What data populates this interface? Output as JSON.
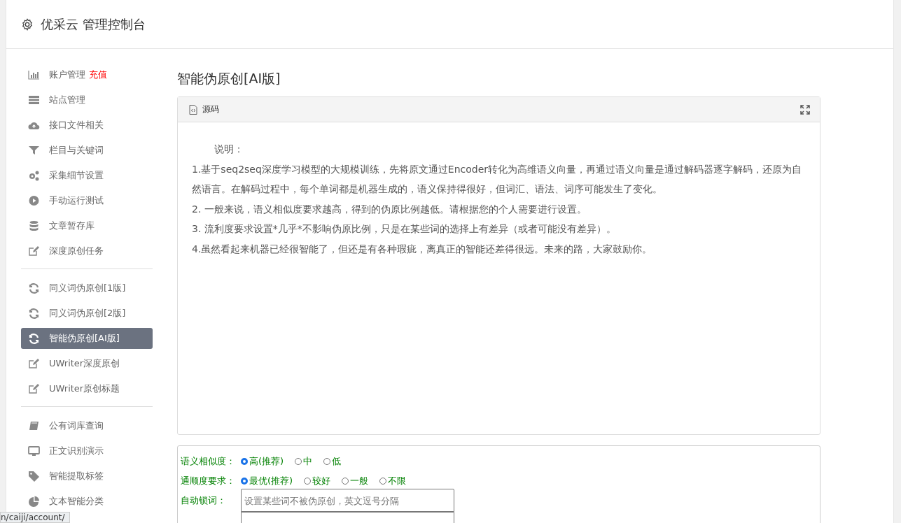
{
  "header": {
    "title": "优采云 管理控制台"
  },
  "sidebar": {
    "groups": [
      {
        "items": [
          {
            "label": "账户管理",
            "badge": "充值",
            "selected": false
          },
          {
            "label": "站点管理",
            "selected": false
          },
          {
            "label": "接口文件相关",
            "selected": false
          },
          {
            "label": "栏目与关键词",
            "selected": false
          },
          {
            "label": "采集细节设置",
            "selected": false
          },
          {
            "label": "手动运行测试",
            "selected": false
          },
          {
            "label": "文章暂存库",
            "selected": false
          },
          {
            "label": "深度原创任务",
            "selected": false
          }
        ]
      },
      {
        "items": [
          {
            "label": "同义词伪原创[1版]",
            "selected": false
          },
          {
            "label": "同义词伪原创[2版]",
            "selected": false
          },
          {
            "label": "智能伪原创[AI版]",
            "selected": true
          },
          {
            "label": "UWriter深度原创",
            "selected": false
          },
          {
            "label": "UWriter原创标题",
            "selected": false
          }
        ]
      },
      {
        "items": [
          {
            "label": "公有词库查询",
            "selected": false
          },
          {
            "label": "正文识别演示",
            "selected": false
          },
          {
            "label": "智能提取标签",
            "selected": false
          },
          {
            "label": "文本智能分类",
            "selected": false
          }
        ]
      }
    ]
  },
  "page_title": "智能伪原创[AI版]",
  "editor": {
    "toolbar_label": "源码",
    "heading": "说明：",
    "paragraphs": [
      "1.基于seq2seq深度学习模型的大规模训练，先将原文通过Encoder转化为高维语义向量，再通过语义向量是通过解码器逐字解码，还原为自然语言。在解码过程中，每个单词都是机器生成的，语义保持得很好，但词汇、语法、词序可能发生了变化。",
      "2. 一般来说，语义相似度要求越高，得到的伪原比例越低。请根据您的个人需要进行设置。",
      "3. 流利度要求设置*几乎*不影响伪原比例，只是在某些词的选择上有差异（或者可能没有差异）。",
      "4.虽然看起来机器已经很智能了，但还是有各种瑕疵，离真正的智能还差得很远。未来的路，大家鼓励你。"
    ]
  },
  "options": {
    "radio_groups": [
      {
        "label": "语义相似度：",
        "options": [
          {
            "label": "高(推荐)",
            "selected": true
          },
          {
            "label": "中",
            "selected": false
          },
          {
            "label": "低",
            "selected": false
          }
        ]
      },
      {
        "label": "通顺度要求：",
        "options": [
          {
            "label": "最优(推荐)",
            "selected": true
          },
          {
            "label": "较好",
            "selected": false
          },
          {
            "label": "一般",
            "selected": false
          },
          {
            "label": "不限",
            "selected": false
          }
        ]
      }
    ],
    "lock_words": {
      "label": "自动锁词：",
      "placeholder": "设置某些词不被伪原创，英文逗号分隔"
    }
  },
  "status_url": "n/caiji/account/"
}
